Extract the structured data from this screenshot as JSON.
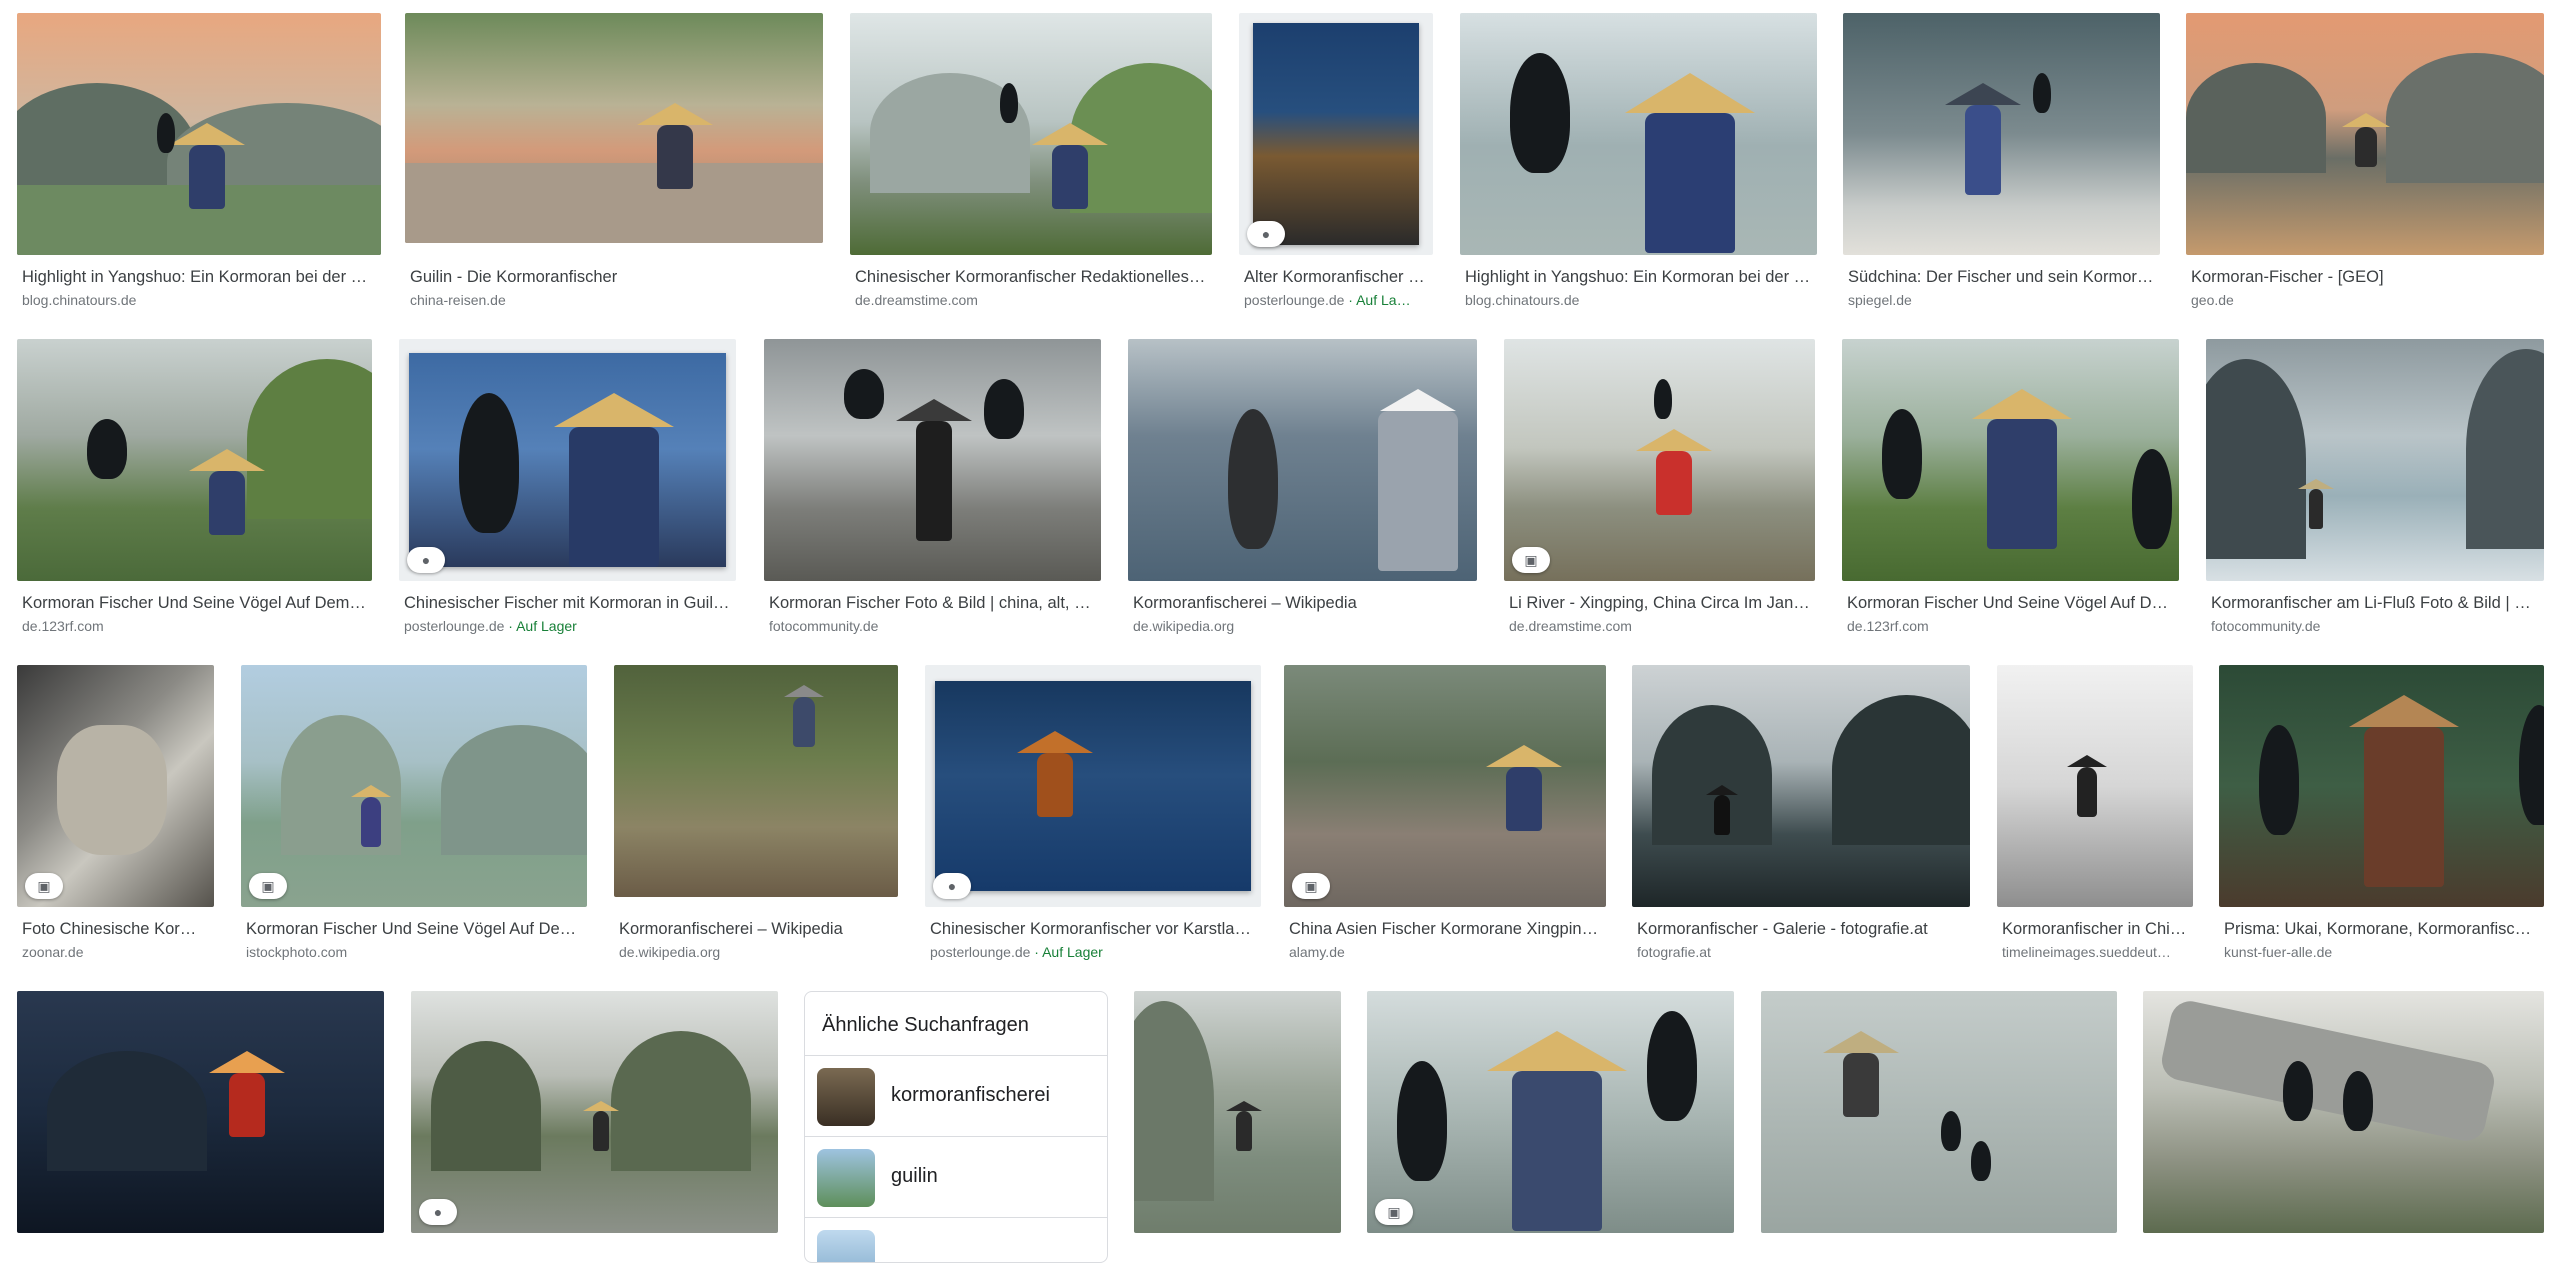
{
  "results": [
    {
      "caption": "Highlight in Yangshuo: Ein Kormoran bei der …",
      "source": "blog.chinatours.de",
      "stock": "",
      "badge": ""
    },
    {
      "caption": "Guilin - Die Kormoranfischer",
      "source": "china-reisen.de",
      "stock": "",
      "badge": ""
    },
    {
      "caption": "Chinesischer Kormoranfischer Redaktionelles…",
      "source": "de.dreamstime.com",
      "stock": "",
      "badge": ""
    },
    {
      "caption": "Alter Kormoranfischer i…",
      "source": "posterlounge.de",
      "stock": " · Auf La…",
      "badge": "tag-icon"
    },
    {
      "caption": "Highlight in Yangshuo: Ein Kormoran bei der …",
      "source": "blog.chinatours.de",
      "stock": "",
      "badge": ""
    },
    {
      "caption": "Südchina: Der Fischer und sein Kormor…",
      "source": "spiegel.de",
      "stock": "",
      "badge": ""
    },
    {
      "caption": "Kormoran-Fischer - [GEO]",
      "source": "geo.de",
      "stock": "",
      "badge": ""
    },
    {
      "caption": "Kormoran Fischer Und Seine Vögel Auf Dem …",
      "source": "de.123rf.com",
      "stock": "",
      "badge": ""
    },
    {
      "caption": "Chinesischer Fischer mit Kormoran in Guili…",
      "source": "posterlounge.de",
      "stock": " · Auf Lager",
      "badge": "tag-icon"
    },
    {
      "caption": "Kormoran Fischer Foto & Bild | china, alt, …",
      "source": "fotocommunity.de",
      "stock": "",
      "badge": ""
    },
    {
      "caption": "Kormoranfischerei – Wikipedia",
      "source": "de.wikipedia.org",
      "stock": "",
      "badge": ""
    },
    {
      "caption": "Li River - Xingping, China Circa Im Jan…",
      "source": "de.dreamstime.com",
      "stock": "",
      "badge": "image-icon"
    },
    {
      "caption": "Kormoran Fischer Und Seine Vögel Auf De…",
      "source": "de.123rf.com",
      "stock": "",
      "badge": ""
    },
    {
      "caption": "Kormoranfischer am Li-Fluß Foto & Bild | a…",
      "source": "fotocommunity.de",
      "stock": "",
      "badge": ""
    },
    {
      "caption": "Foto Chinesische Korm…",
      "source": "zoonar.de",
      "stock": "",
      "badge": "image-icon"
    },
    {
      "caption": "Kormoran Fischer Und Seine Vögel Auf De…",
      "source": "istockphoto.com",
      "stock": "",
      "badge": "image-icon"
    },
    {
      "caption": "Kormoranfischerei – Wikipedia",
      "source": "de.wikipedia.org",
      "stock": "",
      "badge": ""
    },
    {
      "caption": "Chinesischer Kormoranfischer vor Karstla…",
      "source": "posterlounge.de",
      "stock": " · Auf Lager",
      "badge": "tag-icon"
    },
    {
      "caption": "China Asien Fischer Kormorane Xingpin…",
      "source": "alamy.de",
      "stock": "",
      "badge": "image-icon"
    },
    {
      "caption": "Kormoranfischer - Galerie - fotografie.at",
      "source": "fotografie.at",
      "stock": "",
      "badge": ""
    },
    {
      "caption": "Kormoranfischer in Chi…",
      "source": "timelineimages.sueddeut…",
      "stock": "",
      "badge": ""
    },
    {
      "caption": "Prisma: Ukai, Kormorane, Kormoranfisch…",
      "source": "kunst-fuer-alle.de",
      "stock": "",
      "badge": ""
    },
    {
      "caption": "",
      "source": "",
      "stock": "",
      "badge": ""
    },
    {
      "caption": "",
      "source": "",
      "stock": "",
      "badge": "tag-icon"
    },
    {
      "caption": "",
      "source": "",
      "stock": "",
      "badge": ""
    },
    {
      "caption": "",
      "source": "",
      "stock": "",
      "badge": "image-icon"
    },
    {
      "caption": "",
      "source": "",
      "stock": "",
      "badge": ""
    },
    {
      "caption": "",
      "source": "",
      "stock": "",
      "badge": ""
    }
  ],
  "related": {
    "title": "Ähnliche Suchanfragen",
    "items": [
      {
        "label": "kormoranfischerei"
      },
      {
        "label": "guilin"
      },
      {
        "label": ""
      }
    ]
  },
  "colors": {
    "stock_green": "#188038",
    "caption": "#3c4043",
    "source": "#70757a",
    "border": "#dadce0"
  }
}
